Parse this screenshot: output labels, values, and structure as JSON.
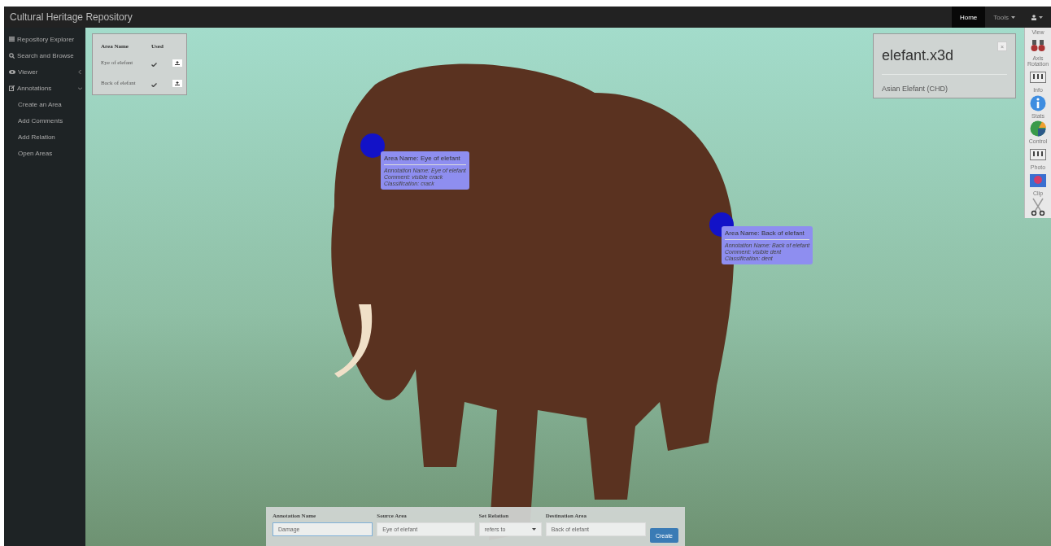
{
  "navbar": {
    "brand": "Cultural Heritage Repository",
    "links": [
      {
        "label": "Home",
        "selected": true,
        "kind": "link"
      },
      {
        "label": "Tools",
        "selected": false,
        "kind": "dropdown"
      },
      {
        "selected": false,
        "kind": "user"
      }
    ]
  },
  "sidebar": {
    "items": [
      {
        "label": "Repository Explorer",
        "kind": "list"
      },
      {
        "label": "Search and Browse",
        "kind": "search"
      },
      {
        "label": "Viewer",
        "kind": "eye",
        "expanded": false
      },
      {
        "label": "Annotations",
        "kind": "edit",
        "expanded": true,
        "children": [
          {
            "label": "Create an Area"
          },
          {
            "label": "Add Comments"
          },
          {
            "label": "Add Relation"
          },
          {
            "label": "Open Areas"
          }
        ]
      }
    ]
  },
  "areas_table": {
    "columns": [
      "Area Name",
      "Used"
    ],
    "rows": [
      {
        "name": "Eye of elefant",
        "used": true
      },
      {
        "name": "Back of elefant",
        "used": true
      }
    ]
  },
  "info_panel": {
    "title": "elefant.x3d",
    "close": "×",
    "description": "Asian Elefant (CHD)"
  },
  "annotations": [
    {
      "title": "Area Name: Eye of elefant",
      "lines": [
        "Annotation Name: Eye of elefant",
        "Comment: visible crack",
        "Classification: crack"
      ]
    },
    {
      "title": "Area Name: Back of elefant",
      "lines": [
        "Annotation Name: Back of elefant",
        "Comment: visible dent",
        "Classification: dent"
      ]
    }
  ],
  "toolbar": [
    {
      "label": "View",
      "kind": "binoculars"
    },
    {
      "label": "Axis Rotation",
      "kind": "panel"
    },
    {
      "label": "Info",
      "kind": "info"
    },
    {
      "label": "Stats",
      "kind": "pie"
    },
    {
      "label": "Control",
      "kind": "panel"
    },
    {
      "label": "Photo",
      "kind": "photo"
    },
    {
      "label": "Clip",
      "kind": "scissors"
    }
  ],
  "relation_form": {
    "fields": [
      {
        "label": "Annotation Name",
        "value": "Damage",
        "kind": "text",
        "focused": true
      },
      {
        "label": "Source Area",
        "value": "Eye of elefant",
        "kind": "text",
        "focused": false
      },
      {
        "label": "Set Relation",
        "value": "refers to",
        "kind": "select",
        "focused": false
      },
      {
        "label": "Destination Area",
        "value": "Back of elefant",
        "kind": "text",
        "focused": false
      }
    ],
    "submit": "Create"
  }
}
